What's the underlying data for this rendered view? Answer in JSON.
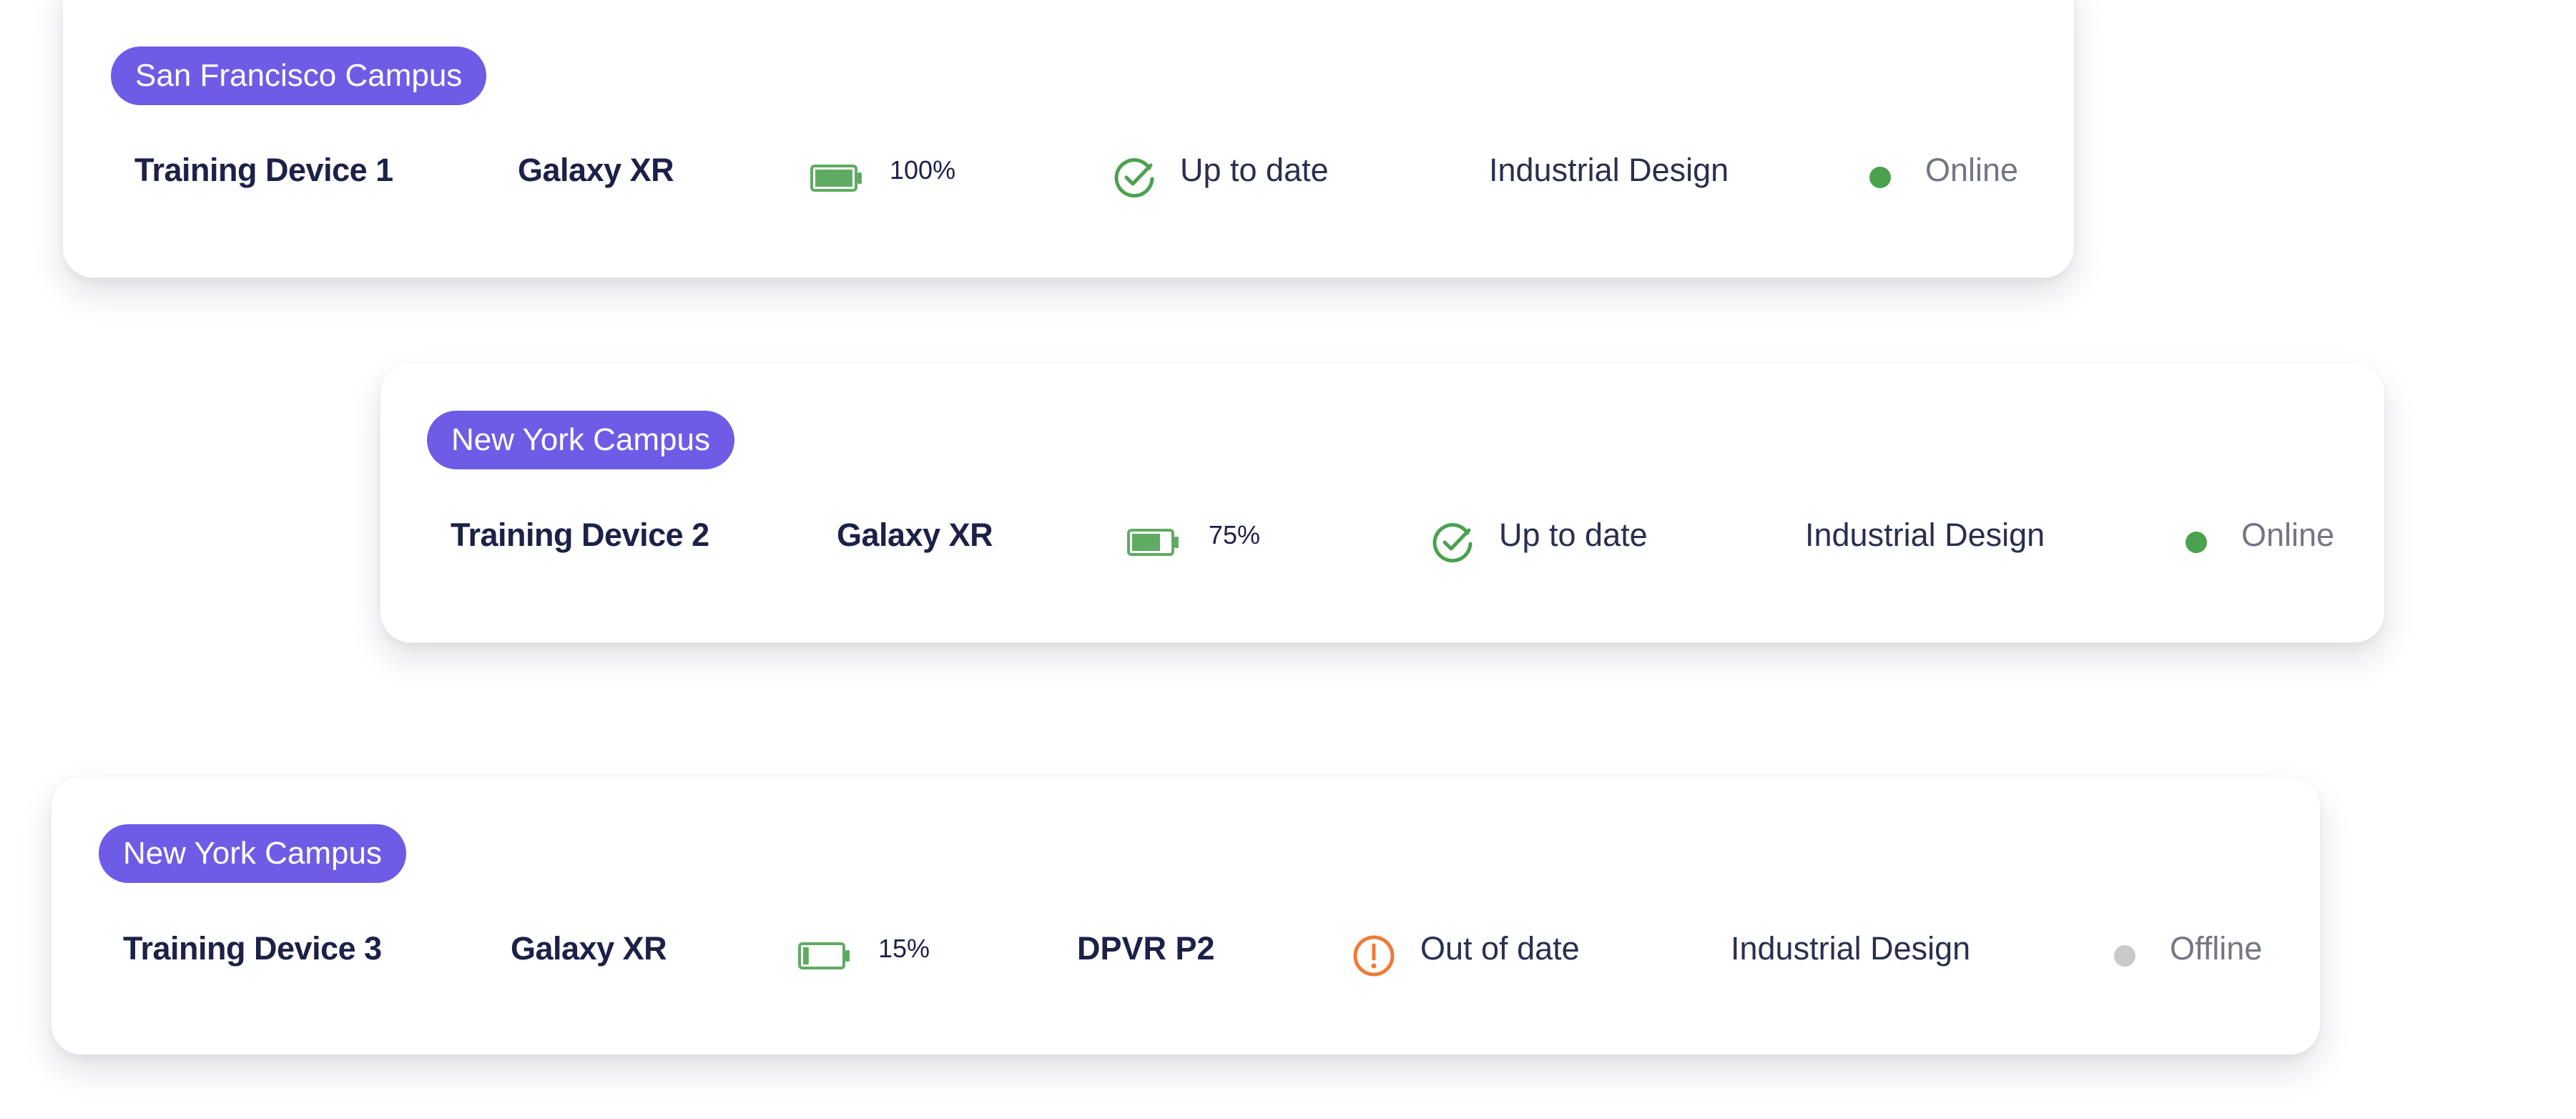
{
  "colors": {
    "accent": "#6e5ce6",
    "online": "#4aa14e",
    "offline": "#c9c9c9",
    "battery": "#5fab62",
    "warning": "#ef7a38"
  },
  "devices": [
    {
      "campus": "San Francisco Campus",
      "name": "Training Device 1",
      "model": "Galaxy XR",
      "battery_text": "100%",
      "battery_level": 1.0,
      "update_status": "Up to date",
      "update_icon": "check-circle-icon",
      "department": "Industrial Design",
      "connection": "Online"
    },
    {
      "campus": "New York Campus",
      "name": "Training Device 2",
      "model": "Galaxy XR",
      "battery_text": "75%",
      "battery_level": 0.75,
      "update_status": "Up to date",
      "update_icon": "check-circle-icon",
      "department": "Industrial Design",
      "connection": "Online"
    },
    {
      "campus": "New York Campus",
      "name": "Training Device 3",
      "model": "Galaxy XR",
      "battery_text": "15%",
      "battery_level": 0.15,
      "version": "DPVR P2",
      "update_status": "Out of date",
      "update_icon": "warning-circle-icon",
      "department": "Industrial Design",
      "connection": "Offline"
    }
  ]
}
